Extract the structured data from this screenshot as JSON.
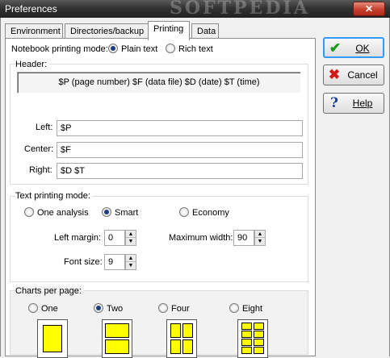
{
  "window": {
    "title": "Preferences",
    "watermark": "SOFTPEDIA",
    "close_glyph": "✕"
  },
  "tabs": [
    {
      "label": "Environment",
      "active": false
    },
    {
      "label": "Directories/backup",
      "active": false
    },
    {
      "label": "Printing",
      "active": true
    },
    {
      "label": "Data",
      "active": false
    }
  ],
  "notebook_mode": {
    "label": "Notebook printing mode:",
    "options": [
      {
        "label": "Plain text",
        "selected": true
      },
      {
        "label": "Rich text",
        "selected": false
      }
    ]
  },
  "header": {
    "group_label": "Header:",
    "codes": "$P (page number)   $F (data file)   $D (date)   $T (time)",
    "left_label": "Left:",
    "left_value": "$P",
    "center_label": "Center:",
    "center_value": "$F",
    "right_label": "Right:",
    "right_value": "$D $T"
  },
  "text_mode": {
    "group_label": "Text printing mode:",
    "options": [
      {
        "label": "One analysis",
        "selected": false
      },
      {
        "label": "Smart",
        "selected": true
      },
      {
        "label": "Economy",
        "selected": false
      }
    ],
    "left_margin_label": "Left margin:",
    "left_margin_value": "0",
    "max_width_label": "Maximum width:",
    "max_width_value": "90",
    "font_size_label": "Font size:",
    "font_size_value": "9"
  },
  "charts_per_page": {
    "group_label": "Charts per page:",
    "options": [
      {
        "label": "One",
        "selected": false
      },
      {
        "label": "Two",
        "selected": true
      },
      {
        "label": "Four",
        "selected": false
      },
      {
        "label": "Eight",
        "selected": false
      }
    ],
    "layout_color": "#ffff00"
  },
  "buttons": {
    "ok": {
      "label": "OK",
      "icon": "checkmark-icon"
    },
    "cancel": {
      "label": "Cancel",
      "icon": "cross-icon"
    },
    "help": {
      "label": "Help",
      "icon": "question-icon"
    }
  }
}
